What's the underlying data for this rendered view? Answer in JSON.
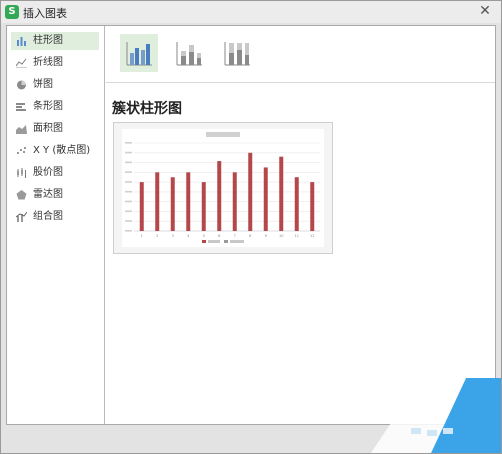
{
  "window": {
    "title": "插入图表",
    "app_icon_letter": "S"
  },
  "sidebar": {
    "items": [
      {
        "label": "柱形图",
        "icon": "column-chart-icon",
        "selected": true
      },
      {
        "label": "折线图",
        "icon": "line-chart-icon",
        "selected": false
      },
      {
        "label": "饼图",
        "icon": "pie-chart-icon",
        "selected": false
      },
      {
        "label": "条形图",
        "icon": "bar-chart-icon",
        "selected": false
      },
      {
        "label": "面积图",
        "icon": "area-chart-icon",
        "selected": false
      },
      {
        "label": "X Y (散点图)",
        "icon": "scatter-chart-icon",
        "selected": false
      },
      {
        "label": "股价图",
        "icon": "stock-chart-icon",
        "selected": false
      },
      {
        "label": "雷达图",
        "icon": "radar-chart-icon",
        "selected": false
      },
      {
        "label": "组合图",
        "icon": "combo-chart-icon",
        "selected": false
      }
    ]
  },
  "subtypes": [
    {
      "icon": "clustered-column-icon",
      "selected": true
    },
    {
      "icon": "stacked-column-icon",
      "selected": false
    },
    {
      "icon": "percent-stacked-column-icon",
      "selected": false
    }
  ],
  "main": {
    "heading": "簇状柱形图"
  },
  "colors": {
    "selected_bg": "#dfeedd",
    "bar": "#b3474a",
    "accent_blue": "#4a7fbf",
    "watermark_blue": "#3ba3e8"
  },
  "chart_data": {
    "type": "bar",
    "title": "",
    "categories": [
      "1",
      "2",
      "3",
      "4",
      "5",
      "6",
      "7",
      "8",
      "9",
      "10",
      "11",
      "12"
    ],
    "values": [
      10,
      12,
      11,
      12,
      10,
      14.3,
      12,
      16,
      13,
      15.2,
      11,
      10
    ],
    "ylim": [
      0,
      18
    ],
    "grid": true,
    "legend_position": "bottom"
  }
}
